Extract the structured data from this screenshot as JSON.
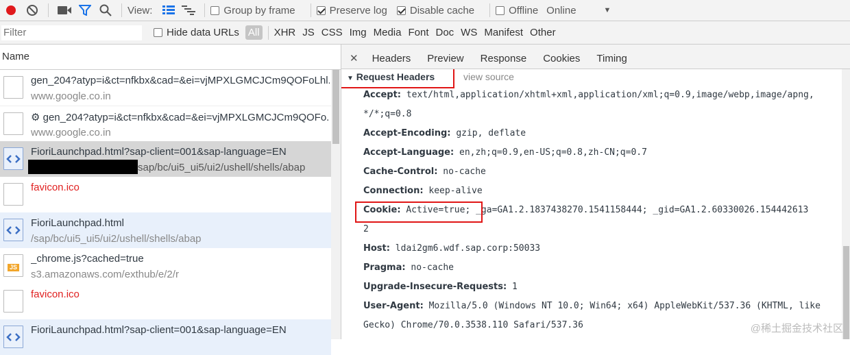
{
  "toolbar": {
    "record_icon": "record-icon",
    "clear_icon": "clear-icon",
    "camera_icon": "camera-icon",
    "filter_icon": "filter-icon",
    "search_icon": "search-icon",
    "view_label": "View:",
    "group_by_frame": "Group by frame",
    "preserve_log": "Preserve log",
    "disable_cache": "Disable cache",
    "offline": "Offline",
    "throttle": "Online",
    "dropdown_arrow": "▼"
  },
  "filterbar": {
    "placeholder": "Filter",
    "hide_data_urls": "Hide data URLs",
    "types": [
      "All",
      "XHR",
      "JS",
      "CSS",
      "Img",
      "Media",
      "Font",
      "Doc",
      "WS",
      "Manifest",
      "Other"
    ]
  },
  "requests": {
    "column_name": "Name",
    "items": [
      {
        "name": "gen_204?atyp=i&ct=nfkbx&cad=&ei=vjMPXLGMCJCm9QOFoLhl...",
        "sub": "www.google.co.in"
      },
      {
        "name": "⚙ gen_204?atyp=i&ct=nfkbx&cad=&ei=vjMPXLGMCJCm9QOFo...",
        "sub": "www.google.co.in"
      },
      {
        "name": "FioriLaunchpad.html?sap-client=001&sap-language=EN",
        "sub": "sap/bc/ui5_ui5/ui2/ushell/shells/abap"
      },
      {
        "name": "favicon.ico",
        "sub": ""
      },
      {
        "name": "FioriLaunchpad.html",
        "sub": "/sap/bc/ui5_ui5/ui2/ushell/shells/abap"
      },
      {
        "name": "_chrome.js?cached=true",
        "sub": "s3.amazonaws.com/exthub/e/2/r"
      },
      {
        "name": "favicon.ico",
        "sub": ""
      },
      {
        "name": "FioriLaunchpad.html?sap-client=001&sap-language=EN",
        "sub": ""
      }
    ]
  },
  "detail": {
    "tabs": [
      "Headers",
      "Preview",
      "Response",
      "Cookies",
      "Timing"
    ],
    "section_title": "Request Headers",
    "view_source": "view source",
    "headers": [
      {
        "key": "Accept:",
        "value": "text/html,application/xhtml+xml,application/xml;q=0.9,image/webp,image/apng,"
      },
      {
        "key": "",
        "value": "*/*;q=0.8"
      },
      {
        "key": "Accept-Encoding:",
        "value": "gzip, deflate"
      },
      {
        "key": "Accept-Language:",
        "value": "en,zh;q=0.9,en-US;q=0.8,zh-CN;q=0.7"
      },
      {
        "key": "Cache-Control:",
        "value": "no-cache"
      },
      {
        "key": "Connection:",
        "value": "keep-alive"
      },
      {
        "key": "Cookie:",
        "value": "Active=true; _ga=GA1.2.1837438270.1541158444; _gid=GA1.2.60330026.154442613"
      },
      {
        "key": "",
        "value": "2"
      },
      {
        "key": "Host:",
        "value": "ldai2gm6.wdf.sap.corp:50033"
      },
      {
        "key": "Pragma:",
        "value": "no-cache"
      },
      {
        "key": "Upgrade-Insecure-Requests:",
        "value": "1"
      },
      {
        "key": "User-Agent:",
        "value": "Mozilla/5.0 (Windows NT 10.0; Win64; x64) AppleWebKit/537.36 (KHTML, like"
      },
      {
        "key": "",
        "value": "Gecko) Chrome/70.0.3538.110 Safari/537.36"
      }
    ]
  },
  "watermark": "@稀土掘金技术社区",
  "colors": {
    "record": "#e0191c",
    "accent": "#1a73e8",
    "highlight": "#e01515",
    "selected_row": "#d6d6d6",
    "alt_row": "#e8f0fb"
  }
}
